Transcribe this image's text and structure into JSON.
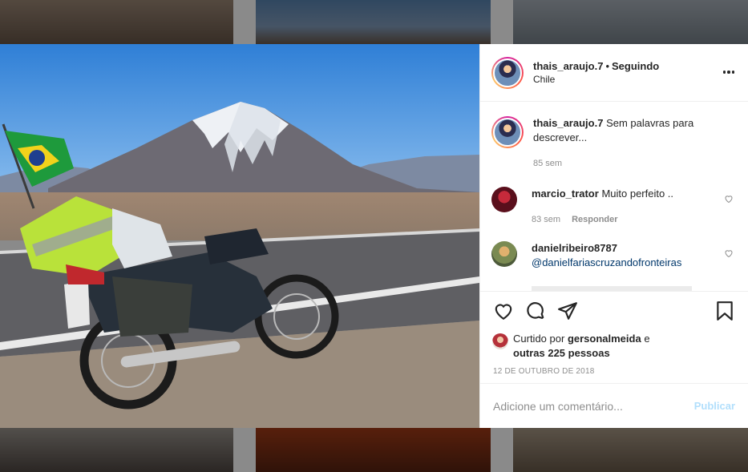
{
  "post": {
    "username": "thais_araujo.7",
    "separator": "•",
    "follow_status": "Seguindo",
    "location": "Chile"
  },
  "caption": {
    "username": "thais_araujo.7",
    "text": "Sem palavras para descrever...",
    "time": "85 sem"
  },
  "comments": [
    {
      "username": "marcio_trator",
      "text": "Muito perfeito ..",
      "time": "83 sem",
      "reply": "Responder"
    },
    {
      "username": "danielribeiro8787",
      "text": "@danielfariascruzandofronteiras"
    }
  ],
  "likes": {
    "prefix": "Curtido por",
    "user": "gersonalmeida",
    "and": "e",
    "others": "outras 225 pessoas"
  },
  "date": "12 DE OUTUBRO DE 2018",
  "add_comment": {
    "placeholder": "Adicione um comentário...",
    "publish": "Publicar"
  },
  "icons": {
    "like": "heart-icon",
    "comment": "comment-icon",
    "share": "share-icon",
    "save": "bookmark-icon",
    "more": "more-options-icon"
  },
  "colors": {
    "link": "#00376b",
    "muted": "#8e8e8e",
    "publish_disabled": "#b2dffc"
  }
}
